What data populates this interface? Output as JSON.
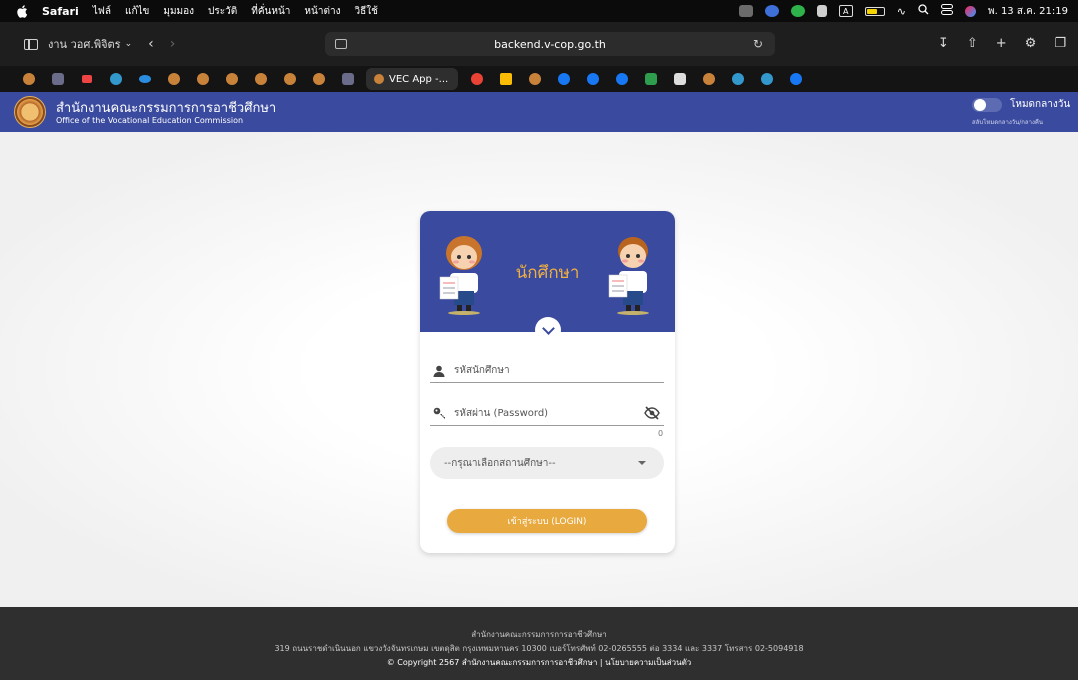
{
  "menubar": {
    "app": "Safari",
    "items": [
      "ไฟล์",
      "แก้ไข",
      "มุมมอง",
      "ประวัติ",
      "ที่คั่นหน้า",
      "หน้าต่าง",
      "วิธีใช้"
    ],
    "datetime": "พ. 13 ส.ค. 21:19",
    "input_source": "A"
  },
  "toolbar": {
    "tab_group": "งาน วอศ.พิจิตร",
    "url": "backend.v-cop.go.th"
  },
  "tabs": {
    "active_label": "VEC App -..."
  },
  "header": {
    "org_th": "สำนักงานคณะกรรมการการอาชีวศึกษา",
    "org_en": "Office of the Vocational Education Commission",
    "mode_label": "โหมดกลางวัน",
    "mode_sub": "สลับโหมดกลางวัน/กลางคืน"
  },
  "login": {
    "title": "นักศึกษา",
    "username_placeholder": "รหัสนักศึกษา",
    "password_placeholder": "รหัสผ่าน (Password)",
    "password_counter": "0",
    "institution_placeholder": "--กรุณาเลือกสถานศึกษา--",
    "login_button": "เข้าสู่ระบบ (LOGIN)"
  },
  "footer": {
    "line1": "สำนักงานคณะกรรมการการอาชีวศึกษา",
    "line2": "319 ถนนราชดำเนินนอก แขวงวังจันทรเกษม เขตดุสิต กรุงเทพมหานคร 10300 เบอร์โทรศัพท์ 02-0265555 ต่อ 3334 และ 3337 โทรสาร 02-5094918",
    "line3": "© Copyright 2567 สำนักงานคณะกรรมการการอาชีวศึกษา | นโยบายความเป็นส่วนตัว"
  },
  "colors": {
    "brand_blue": "#3a4a9e",
    "accent_orange": "#e8a93e",
    "title_gold": "#f0b040"
  }
}
